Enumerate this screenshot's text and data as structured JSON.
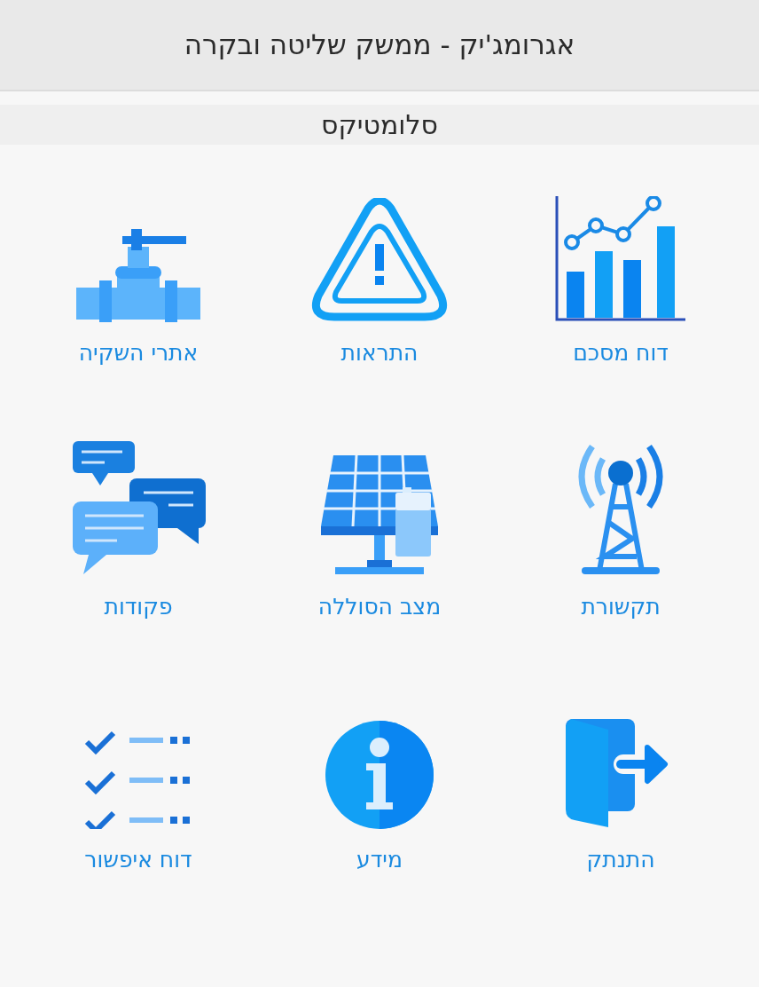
{
  "header": {
    "title": "אגרומג'יק - ממשק שליטה ובקרה"
  },
  "subheader": {
    "title": "סלומטיקס"
  },
  "tiles": [
    {
      "kind": "chart",
      "label": "דוח מסכם"
    },
    {
      "kind": "warning",
      "label": "התראות"
    },
    {
      "kind": "valve",
      "label": "אתרי השקיה"
    },
    {
      "kind": "tower",
      "label": "תקשורת"
    },
    {
      "kind": "solar",
      "label": "מצב הסוללה"
    },
    {
      "kind": "chat",
      "label": "פקודות"
    },
    {
      "kind": "logout",
      "label": "התנתק"
    },
    {
      "kind": "info",
      "label": "מידע"
    },
    {
      "kind": "checklist",
      "label": "דוח איפשור"
    }
  ]
}
